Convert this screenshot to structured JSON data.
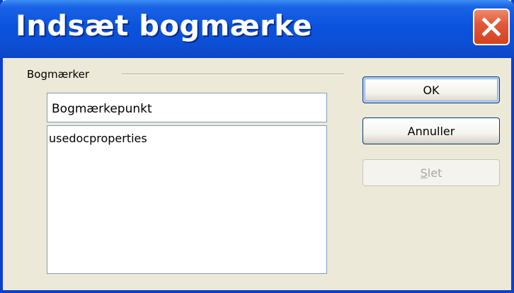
{
  "window": {
    "title": "Indsæt bogmærke",
    "close_icon": "close-icon",
    "title_color": "#0b4fd6",
    "close_color": "#d2421f"
  },
  "group": {
    "label": "Bogmærker"
  },
  "name_field": {
    "value": "Bogmærkepunkt"
  },
  "bookmarks_list": {
    "items": [
      "usedocproperties"
    ]
  },
  "buttons": {
    "ok": "OK",
    "cancel": "Annuller",
    "delete_prefix": "",
    "delete_accel": "S",
    "delete_rest": "let"
  }
}
